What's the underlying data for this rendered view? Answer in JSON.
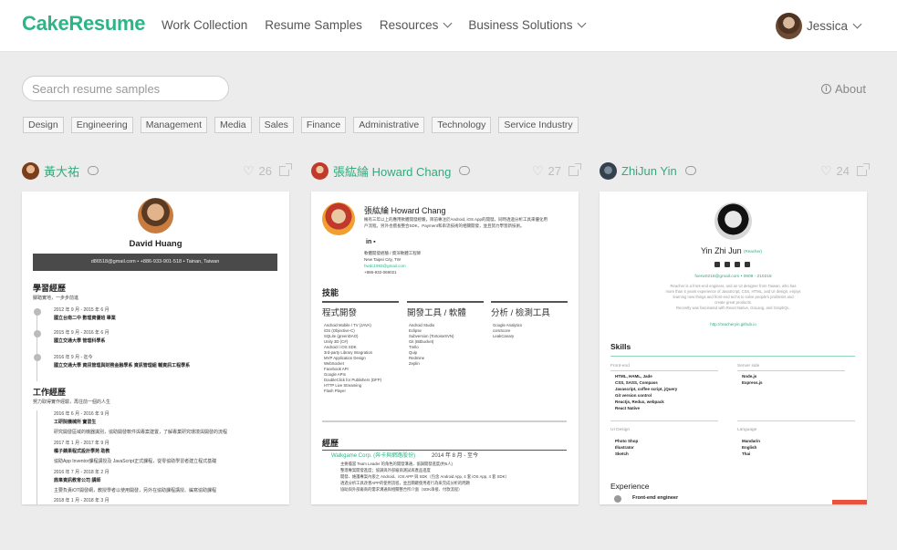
{
  "header": {
    "logo": "CakeResume",
    "nav": [
      "Work Collection",
      "Resume Samples",
      "Resources",
      "Business Solutions"
    ],
    "user_name": "Jessica"
  },
  "search": {
    "placeholder": "Search resume samples"
  },
  "about_label": "About",
  "tags": [
    "Design",
    "Engineering",
    "Management",
    "Media",
    "Sales",
    "Finance",
    "Administrative",
    "Technology",
    "Service Industry"
  ],
  "cards": [
    {
      "author": "黃大祐",
      "likes": "26",
      "preview": {
        "name": "David Huang",
        "contact": "d86518@gmail.com  •  +886-933-901-518  •  Tainan, Taiwan",
        "section_education": "學習經歷",
        "education_sub": "腳踏實地，一步步前進",
        "edu_entries": [
          "國立台南二中 數理資優班 畢業",
          "國立交通大學 管理科學系",
          "國立交通大學 資訊管理與財務金融學系 資訊管理組 輔資訊工程學系"
        ],
        "edu_dates": [
          "2012 年 9 月 - 2015 年 6 月",
          "2015 年 9 月 - 2016 年 6 月",
          "2016 年 9 月 - 迄今"
        ],
        "section_work": "工作經歷",
        "work_sub": "努力取得實作經驗，再往前一個的人生",
        "work_entries": [
          "工研院機械所 實習生",
          "橘子蘋果程式設計學苑 助教",
          "鼎韋資訊教育公司 講師"
        ],
        "work_dates": [
          "2016 年 6 月 - 2016 年 9 月",
          "2017 年 1 月 - 2017 年 9 月",
          "2016 年 7 月 - 2018 年 2 月",
          "2018 年 1 月 - 2018 年 3 月"
        ],
        "work_notes": [
          "研究開發區域的機器識別，協助開發軟件與專案建置，了解專業研究環境與開發的流程",
          "協助App Inventor課程講授及 JavaScript正式課程，從零協助學習者建立程式基礎",
          "主要負責iOT開發網，教授學者以使用開發，另外在協助課程講授、編寫協助課程"
        ]
      }
    },
    {
      "author": "張紘綸 Howard Chang",
      "likes": "27",
      "preview": {
        "name": "張紘綸 Howard Chang",
        "intro": "擁有三年以上的應用軟體開發經驗，目前專注於Android, iOS App的開發。同時透過分析工具來優化用戶流程。另外也擅長整合SDK，Payment和串流技術的相關開發，並且努力學習新技術。",
        "contact": [
          "軟體開發經驗 / 資深軟體工程師",
          "New Taipei City,  TW",
          "hwdc1993@gmail.com",
          "+886-932-069021"
        ],
        "section_skills": "技能",
        "cols": [
          "程式開發",
          "開發工具 / 軟體",
          "分析 / 檢測工具"
        ],
        "col1": [
          "Android Mobile / TV (JAVA)",
          "iOS (Objective-C)",
          "SQLite (greenDAO)",
          "Unity 3D (C#)",
          "Android / iOS SDK",
          "3rd-party Library Integration",
          "MVP Application Design",
          "WebSocket",
          "Facebook API",
          "Google APIs",
          "DoubleClick for Publishers (DFP)",
          "HTTP Live Streaming",
          "Flash Player"
        ],
        "col2": [
          "Android Studio",
          "Eclipse",
          "Subversion (TortoiseSVN)",
          "Git (Bitbucket)",
          "Trello",
          "Quip",
          "Redmine",
          "Zeplin"
        ],
        "col3": [
          "Google Analytics",
          "comScore",
          "LeakCanary"
        ],
        "section_exp": "經歷",
        "exp_company": "Walkgame Corp. (奔卡與網路股份)",
        "exp_date": "2014 年 8 月 - 至今",
        "exp_items": [
          "主要擔當 Team Leader 的角色的開發溝通，協調開發進度(約5人)",
          "整理專案開發進度；協調與外部廠商測試與產品進度",
          "開發、維護專案內嵌之 Android、iOS APP 與 SDK（包含 Android App, 4 套 iOS App, 4 套 SDK）",
          "透過分析工具改善APP的使用流程，並且關鍵使用者行為來完成分析的問題",
          "協助與外部廠商的需求溝通與相關整合所介面（SDK串接、付款流程）"
        ]
      }
    },
    {
      "author": "ZhiJun Yin",
      "likes": "24",
      "preview": {
        "name": "Yin Zhi Jun",
        "role": "(Reacher)",
        "contact": "fxerw0218@gmail.com  •  0909 - 210218",
        "bio": [
          "Reacher is a front-end engineer, and an UI designer from Taiwan, who has",
          "more than 5 years experience of JavaScript, CSS, HTML, and UI design, enjoys",
          "learning new things and front-end techs to solve people's problems and",
          "create great products.",
          "Recently was fascinated with React Native, GoLang, and GraphQL."
        ],
        "link": "http://reacheryin.github.io",
        "section_skills": "Skills",
        "frontend_label": "Front-end",
        "frontend": [
          "HTML, HAML, Jade",
          "CSS, SASS, Compass",
          "Javascript, coffee script, jQuery",
          "Git version control",
          "Reactjs, Redux, webpack",
          "React Native"
        ],
        "server_label": "Server side",
        "server": [
          "Node.js",
          "Express.js"
        ],
        "ui_label": "UI Design",
        "ui": [
          "Photo Shop",
          "Illustrator",
          "Sketch"
        ],
        "lang_label": "Language",
        "lang": [
          "Mandarin",
          "English",
          "Thai"
        ],
        "section_exp": "Experience",
        "exp_title": "Front-end engineer"
      }
    }
  ],
  "colors": {
    "brand": "#2db487",
    "author": "#36a87d",
    "background": "#ececec"
  }
}
